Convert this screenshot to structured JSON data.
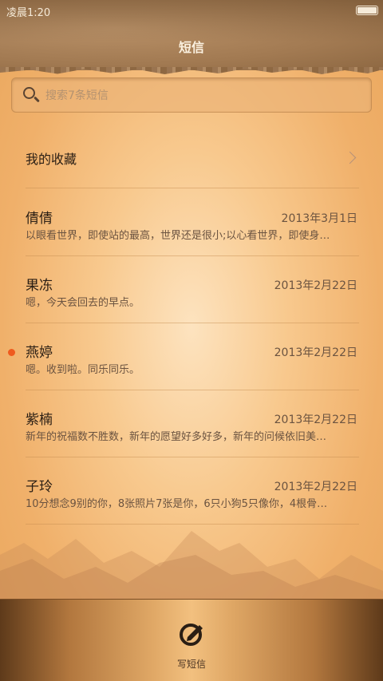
{
  "status_bar": {
    "time": "凌晨1:20"
  },
  "header": {
    "title": "短信"
  },
  "search": {
    "placeholder": "搜索7条短信"
  },
  "favorites": {
    "label": "我的收藏"
  },
  "conversations": [
    {
      "name": "倩倩",
      "date": "2013年3月1日",
      "preview": "以眼看世界，即使站的最高，世界还是很小;以心看世界，即使身…",
      "unread": false
    },
    {
      "name": "果冻",
      "date": "2013年2月22日",
      "preview": "嗯，今天会回去的早点。",
      "unread": false
    },
    {
      "name": "燕婷",
      "date": "2013年2月22日",
      "preview": "嗯。收到啦。同乐同乐。",
      "unread": true
    },
    {
      "name": "紫楠",
      "date": "2013年2月22日",
      "preview": "新年的祝福数不胜数，新年的愿望好多好多，新年的问候依旧美…",
      "unread": false
    },
    {
      "name": "子玲",
      "date": "2013年2月22日",
      "preview": "10分想念9别的你，8张照片7张是你，6只小狗5只像你，4根骨…",
      "unread": false
    }
  ],
  "bottom_bar": {
    "compose_label": "写短信"
  },
  "colors": {
    "unread_dot": "#ef5a1e",
    "header_bg": "#a27a52",
    "bottom_bar_center": "#f2c07f"
  }
}
